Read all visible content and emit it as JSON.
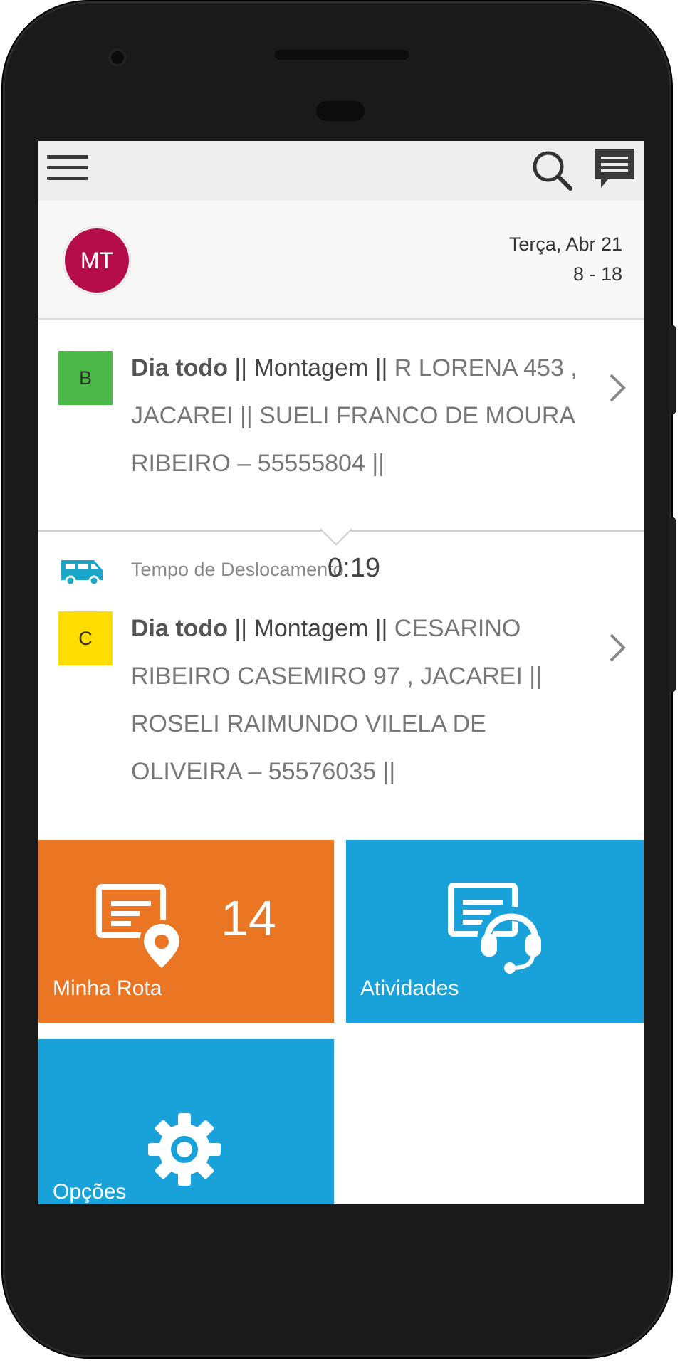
{
  "toolbar": {
    "menu_icon": "hamburger-menu-icon",
    "search_icon": "search-icon",
    "messages_icon": "chat-message-icon"
  },
  "header": {
    "avatar_initials": "MT",
    "avatar_color": "#b50d4a",
    "date": "Terça, Abr 21",
    "hours": "8 - 18"
  },
  "appointments": [
    {
      "badge": "B",
      "badge_color": "#4cb848",
      "bold": "Dia todo",
      "type": " || Montagem || ",
      "details": "R LORENA 453 , JACAREI || SUELI FRANCO DE MOURA RIBEIRO – 55555804 ||"
    },
    {
      "badge": "C",
      "badge_color": "#ffdd00",
      "bold": "Dia todo",
      "type": " || Montagem || ",
      "details": "CESARINO RIBEIRO CASEMIRO 97 , JACAREI || ROSELI RAIMUNDO VILELA DE OLIVEIRA – 55576035 ||"
    }
  ],
  "travel": {
    "icon": "van-icon",
    "label": "Tempo de Deslocamento",
    "time": "0:19"
  },
  "tiles": {
    "route": {
      "label": "Minha Rota",
      "count": "14",
      "color": "#ea7624",
      "icon": "route-map-pin-icon"
    },
    "activities": {
      "label": "Atividades",
      "color": "#18a2d9",
      "icon": "support-headset-icon"
    },
    "options": {
      "label": "Opções",
      "color": "#18a2d9",
      "icon": "gear-icon"
    }
  },
  "colors": {
    "toolbar_bg": "#eeeeee",
    "header_bg": "#f7f7f7",
    "travel_icon": "#1aa6c8"
  }
}
